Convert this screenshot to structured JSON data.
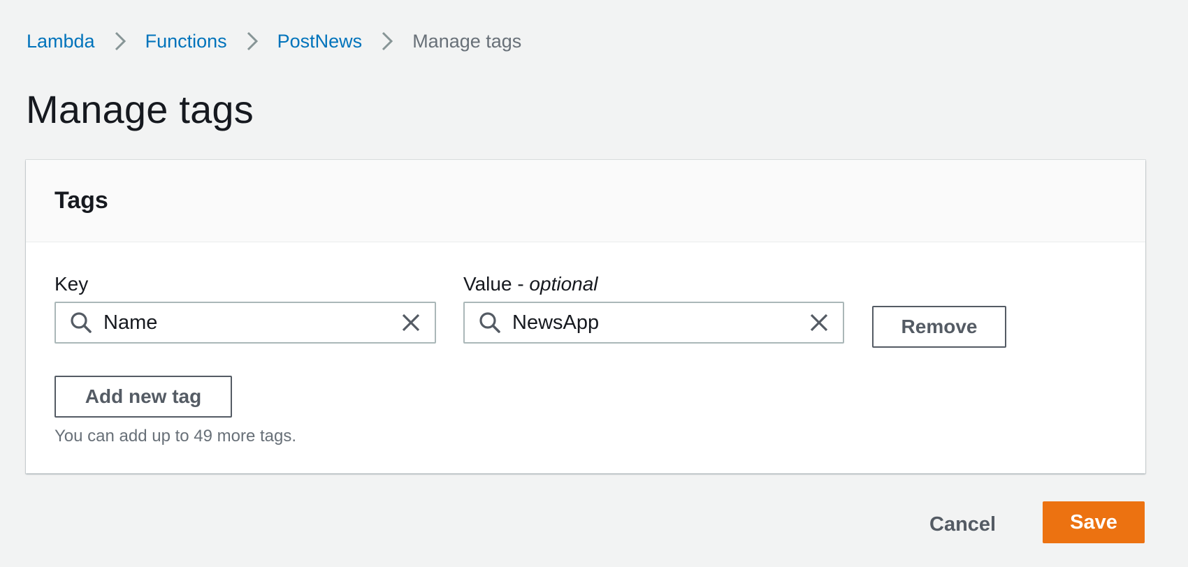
{
  "breadcrumb": {
    "items": [
      {
        "label": "Lambda"
      },
      {
        "label": "Functions"
      },
      {
        "label": "PostNews"
      }
    ],
    "current": "Manage tags"
  },
  "page": {
    "title": "Manage tags"
  },
  "tags_panel": {
    "title": "Tags",
    "key_label": "Key",
    "value_label_main": "Value - ",
    "value_label_optional": "optional",
    "rows": [
      {
        "key": "Name",
        "value": "NewsApp",
        "remove_label": "Remove"
      }
    ],
    "add_label": "Add new tag",
    "hint": "You can add up to 49 more tags."
  },
  "footer": {
    "cancel_label": "Cancel",
    "save_label": "Save"
  },
  "colors": {
    "link": "#0073bb",
    "primary": "#ec7211",
    "background": "#f2f3f3"
  },
  "icons": {
    "separator": "chevron-right-icon",
    "search": "search-icon",
    "clear": "close-icon"
  }
}
